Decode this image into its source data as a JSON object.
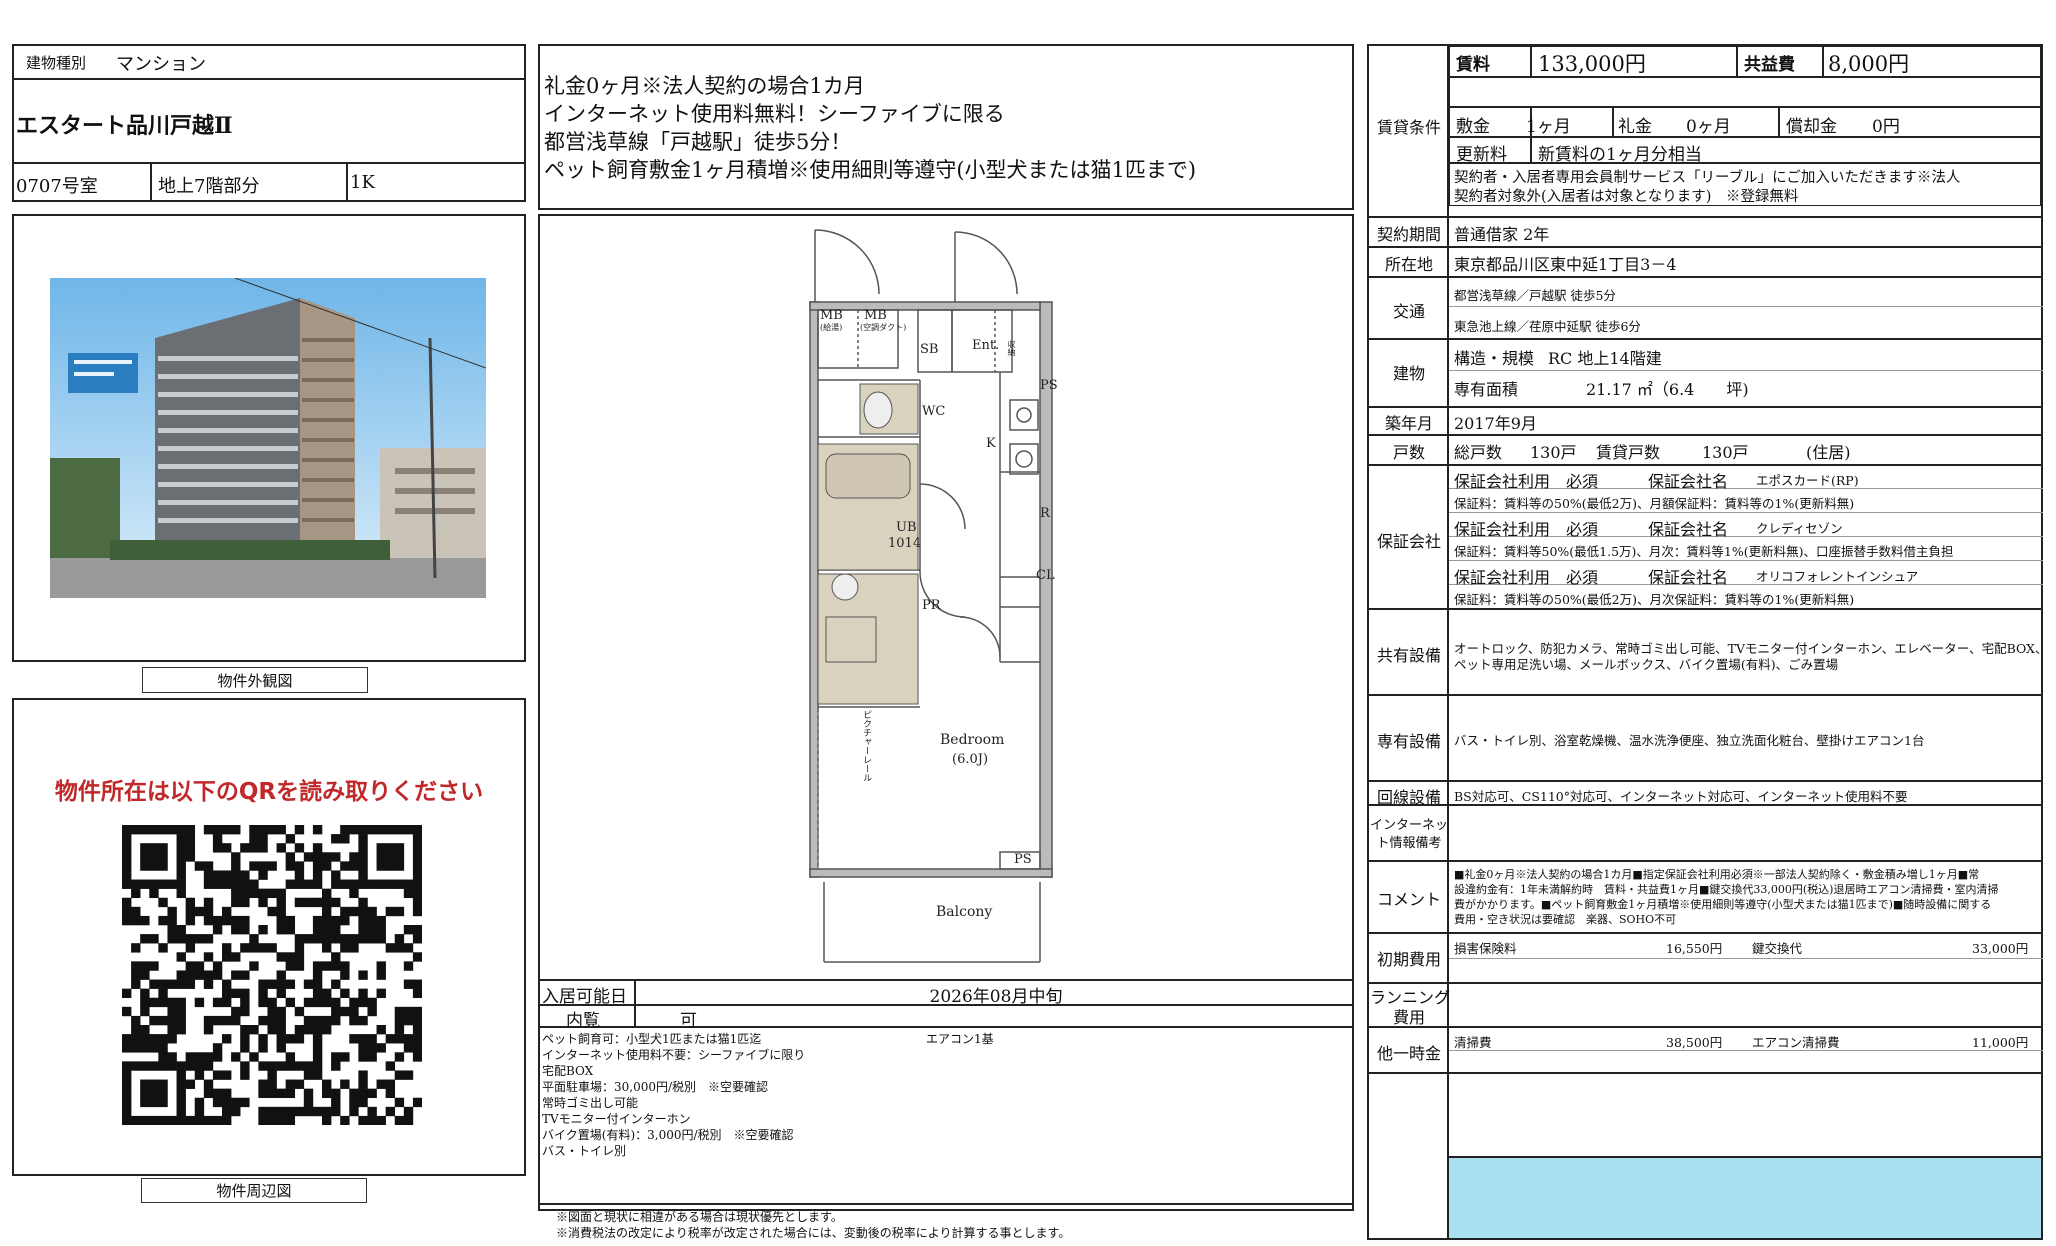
{
  "building_type": {
    "label": "建物種別",
    "value": "マンション"
  },
  "property_name": "エスタート品川戸越Ⅱ",
  "room": {
    "number": "0707号室",
    "floor": "地上7階部分",
    "layout": "1K"
  },
  "highlights": [
    "礼金0ヶ月※法人契約の場合1カ月",
    "インターネット使用料無料！シーファイブに限る",
    "都営浅草線「戸越駅」徒歩5分！",
    "ペット飼育敷金1ヶ月積増※使用細則等遵守(小型犬または猫1匹まで)"
  ],
  "photo_caption": "物件外観図",
  "map_caption": "物件周辺図",
  "qr_message": "物件所在は以下のQRを読み取りください",
  "floorplan": {
    "mb1": "MB",
    "mb1_sub": "(給湯)",
    "mb2": "MB",
    "mb2_sub": "(空調ダクト)",
    "sb": "SB",
    "ent": "Ent.",
    "shoe": "収納",
    "ps1": "PS",
    "wc": "WC",
    "k": "K",
    "ub": "UB",
    "ub_size": "1014",
    "r": "R",
    "cl": "CL",
    "pr": "PR",
    "rail": "ピクチャーレール",
    "bedroom": "Bedroom",
    "bedroom_size": "(6.0J)",
    "ps2": "PS",
    "balcony": "Balcony"
  },
  "availability": {
    "label": "入居可能日",
    "value": "2026年08月中旬"
  },
  "viewing": {
    "label": "内覧",
    "value": "可"
  },
  "notes": [
    "ペット飼育可：小型犬1匹または猫1匹迄",
    "インターネット使用料不要：シーファイブに限り",
    "宅配BOX",
    "平面駐車場：30,000円/税別　※空要確認",
    "常時ゴミ出し可能",
    "TVモニター付インターホン",
    "バイク置場(有料)：3,000円/税別　※空要確認",
    "バス・トイレ別"
  ],
  "notes_right": "エアコン1基",
  "disclaimer": [
    "※図面と現状に相違がある場合は現状優先とします。",
    "※消費税法の改定により税率が改定された場合には、変動後の税率により計算する事とします。"
  ],
  "terms": {
    "label": "賃貸条件",
    "rent_label": "賃料",
    "rent": "133,000円",
    "common_label": "共益費",
    "common": "8,000円",
    "deposit_label": "敷金",
    "deposit": "1ヶ月",
    "key_label": "礼金",
    "key": "0ヶ月",
    "amort_label": "償却金",
    "amort": "0円",
    "renewal_label": "更新料",
    "renewal": "新賃料の1ヶ月分相当",
    "service_note1": "契約者・入居者専用会員制サービス「リーブル」にご加入いただきます※法人",
    "service_note2": "契約者対象外(入居者は対象となります)　※登録無料"
  },
  "contract": {
    "label": "契約期間",
    "value": "普通借家 2年"
  },
  "address": {
    "label": "所在地",
    "value": "東京都品川区東中延1丁目3－4"
  },
  "transport": {
    "label": "交通",
    "line1": "都営浅草線／戸越駅 徒歩5分",
    "line2": "東急池上線／荏原中延駅 徒歩6分"
  },
  "structure": {
    "label": "建物",
    "scale_label": "構造・規模",
    "scale": "RC 地上14階建",
    "area_label": "専有面積",
    "area": "21.17 ㎡（6.4　　坪)"
  },
  "built": {
    "label": "築年月",
    "value": "2017年9月"
  },
  "units": {
    "label": "戸数",
    "total_label": "総戸数",
    "total": "130戸",
    "rental_label": "賃貸戸数",
    "rental": "130戸",
    "note": "(住居)"
  },
  "guarantee": {
    "label": "保証会社",
    "items": [
      {
        "use": "保証会社利用　必須",
        "name_label": "保証会社名",
        "name": "エポスカード(RP)",
        "fee": "保証料：賃料等の50%(最低2万)、月額保証料：賃料等の1%(更新料無)"
      },
      {
        "use": "保証会社利用　必須",
        "name_label": "保証会社名",
        "name": "クレディセゾン",
        "fee": "保証料：賃料等50%(最低1.5万)、月次：賃料等1%(更新料無)、口座振替手数料借主負担"
      },
      {
        "use": "保証会社利用　必須",
        "name_label": "保証会社名",
        "name": "オリコフォレントインシュア",
        "fee": "保証料：賃料等の50%(最低2万)、月次保証料：賃料等の1%(更新料無)"
      }
    ]
  },
  "shared": {
    "label": "共有設備",
    "line1": "オートロック、防犯カメラ、常時ゴミ出し可能、TVモニター付インターホン、エレベーター、宅配BOX、",
    "line2": "ペット専用足洗い場、メールボックス、バイク置場(有料)、ごみ置場"
  },
  "private": {
    "label": "専有設備",
    "value": "バス・トイレ別、浴室乾燥機、温水洗浄便座、独立洗面化粧台、壁掛けエアコン1台"
  },
  "lines": {
    "label": "回線設備",
    "value": "BS対応可、CS110°対応可、インターネット対応可、インターネット使用料不要"
  },
  "internet": {
    "label1": "インターネッ",
    "label2": "ト情報備考"
  },
  "comment": {
    "label": "コメント",
    "lines": [
      "■礼金0ヶ月※法人契約の場合1カ月■指定保証会社利用必須※一部法人契約除く・敷金積み増し1ヶ月■常",
      "設違約金有：1年未満解約時　賃料・共益費1ヶ月■鍵交換代33,000円(税込)退居時エアコン清掃費・室内清掃",
      "費がかかります。■ペット飼育敷金1ヶ月積増※使用細則等遵守(小型犬または猫1匹まで)■随時設備に関する",
      "費用・空き状況は要確認　楽器、SOHO不可"
    ]
  },
  "initial": {
    "label": "初期費用",
    "item1": "損害保険料",
    "amount1": "16,550円",
    "item2": "鍵交換代",
    "amount2": "33,000円"
  },
  "running": {
    "label1": "ランニング",
    "label2": "費用"
  },
  "other": {
    "label": "他一時金",
    "item1": "清掃費",
    "amount1": "38,500円",
    "item2": "エアコン清掃費",
    "amount2": "11,000円"
  },
  "colors": {
    "accent_red": "#c0282a",
    "stamp_blue": "#a9e0f0"
  }
}
